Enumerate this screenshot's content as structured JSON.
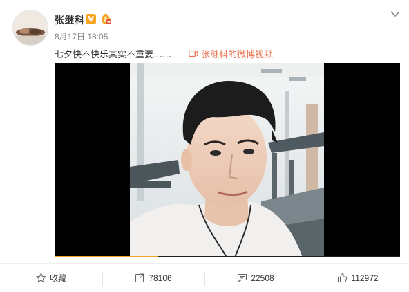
{
  "post": {
    "author": "张继科",
    "verified_badge": "V",
    "vip_icon": "vip-fan-icon",
    "timestamp": "8月17日 18:05",
    "text": "七夕快不快乐其实不重要……",
    "video_link": "张继科的微博视频",
    "video_link_icon": "video-camera-icon",
    "video_progress_fraction": 0.3,
    "menu_icon": "chevron-down-icon"
  },
  "actions": {
    "favorite": {
      "label": "收藏",
      "icon": "star-icon"
    },
    "repost": {
      "label": "78106",
      "icon": "repost-icon"
    },
    "comment": {
      "label": "22508",
      "icon": "comment-icon"
    },
    "like": {
      "label": "112972",
      "icon": "thumbs-up-icon"
    }
  },
  "colors": {
    "accent": "#eb7350",
    "verified": "#f6a623",
    "progress": "#f6a623",
    "muted": "#808080"
  }
}
